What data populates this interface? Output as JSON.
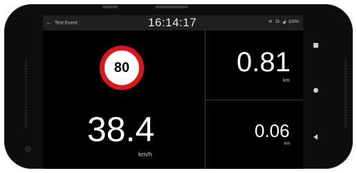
{
  "statusbar": {
    "back_arrow": "←",
    "title": "Test Event",
    "time": "16:14:17",
    "icons": [
      "✉",
      "15",
      "◢",
      "100%"
    ]
  },
  "speed_limit": "80",
  "current_speed": {
    "value": "38.4",
    "unit": "km/h"
  },
  "distance_primary": {
    "value": "0.81",
    "unit": "km"
  },
  "distance_secondary": {
    "value": "0.06",
    "unit": "km"
  },
  "colors": {
    "sign_border": "#e0151c",
    "background": "#000000",
    "statusbar": "#1f1f1f"
  },
  "nav_icons": [
    "recents-icon",
    "home-icon",
    "back-icon"
  ]
}
